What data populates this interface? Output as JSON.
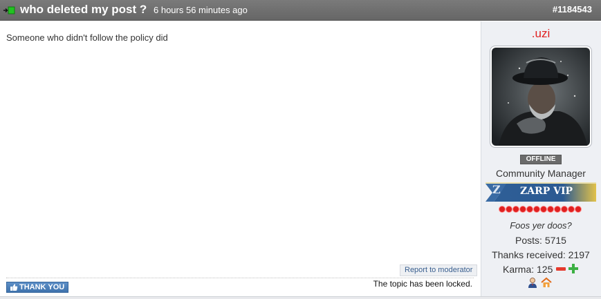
{
  "post": {
    "title": "who deleted my post ?",
    "time": "6 hours 56 minutes ago",
    "id": "#1184543",
    "content": "Someone who didn't follow the policy did",
    "report_label": "Report to moderator",
    "thank_label": "THANK YOU",
    "locked_text": "The topic has been locked."
  },
  "user": {
    "name": ".uzi",
    "status": "OFFLINE",
    "rank": "Community Manager",
    "vip_letter": "Z",
    "vip_label": "ZARP VIP",
    "motto": "Foos yer doos?",
    "posts": "Posts: 5715",
    "thanks": "Thanks received: 2197",
    "karma": "Karma: 125",
    "reputation_dots": 12
  },
  "colors": {
    "header_bg": "#6e6e6e",
    "username": "#e02020",
    "thank_button": "#4a7fb8",
    "karma_minus": "#e53a2d",
    "karma_plus": "#3cb043",
    "rep_dot": "#e02020"
  },
  "icons": {
    "header": "post-new-icon",
    "thank": "thumbs-up-icon",
    "karma_minus": "minus-icon",
    "karma_plus": "plus-icon",
    "profile": "user-profile-icon",
    "home": "home-icon"
  }
}
